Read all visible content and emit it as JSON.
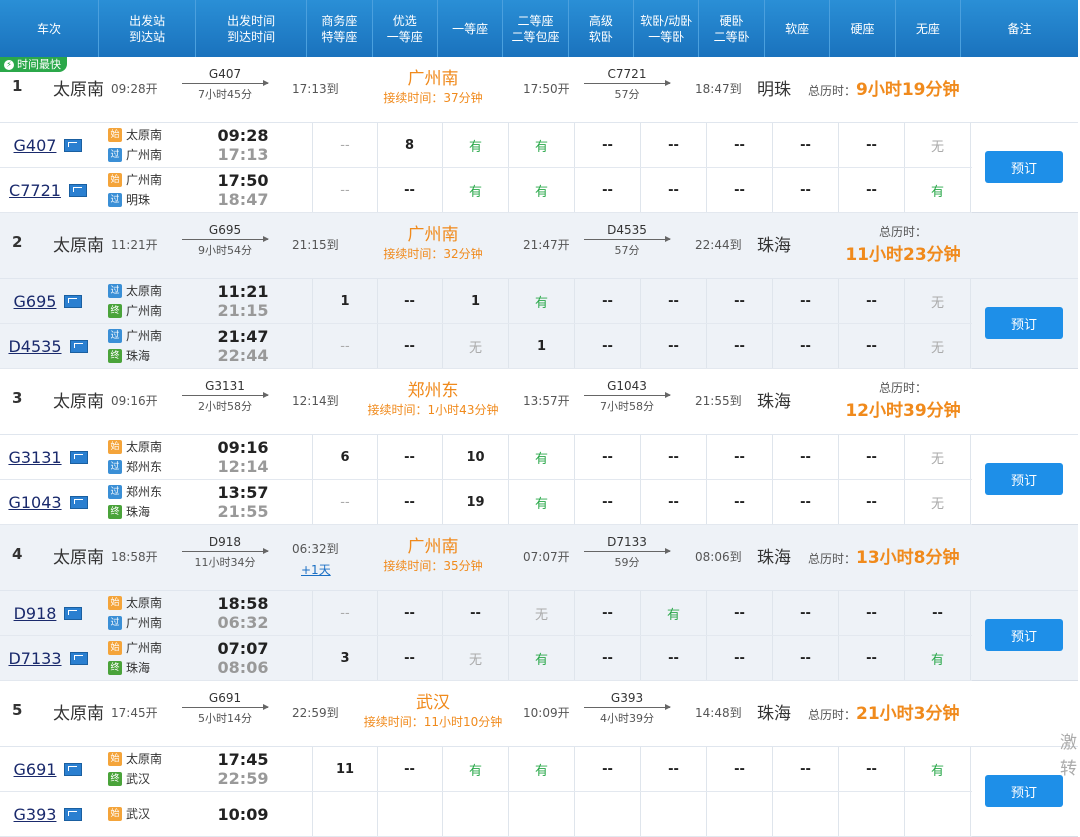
{
  "header": [
    "车次",
    "出发站\n到达站",
    "出发时间\n到达时间",
    "商务座\n特等座",
    "优选\n一等座",
    "一等座",
    "二等座\n二等包座",
    "高级\n软卧",
    "软卧/动卧\n一等卧",
    "硬卧\n二等卧",
    "软座",
    "硬座",
    "无座",
    "备注"
  ],
  "fast_tag": "时间最快",
  "book_label": "预订",
  "side_text": "激\n转",
  "groups": [
    {
      "idx": "1",
      "from": "太原南",
      "dep": "09:28开",
      "leg1": {
        "train": "G407",
        "dur": "7小时45分"
      },
      "arr1": "17:13到",
      "plus": "",
      "transfer_station": "广州南",
      "transfer_time": "接续时间：37分钟",
      "dep2": "17:50开",
      "leg2": {
        "train": "C7721",
        "dur": "57分"
      },
      "arr2": "18:47到",
      "final": "明珠",
      "total_label": "总历时：",
      "total": "9小时19分钟",
      "total_wrap": false,
      "trains": [
        {
          "no": "G407",
          "s1": "太原南",
          "b1": "始",
          "s2": "广州南",
          "b2": "过",
          "t1": "09:28",
          "t2": "17:13",
          "seats": [
            "--",
            "8",
            "有",
            "有",
            "--",
            "--",
            "--",
            "--",
            "--",
            "无"
          ]
        },
        {
          "no": "C7721",
          "s1": "广州南",
          "b1": "始",
          "s2": "明珠",
          "b2": "过",
          "t1": "17:50",
          "t2": "18:47",
          "seats": [
            "--",
            "--",
            "有",
            "有",
            "--",
            "--",
            "--",
            "--",
            "--",
            "有"
          ]
        }
      ]
    },
    {
      "idx": "2",
      "from": "太原南",
      "dep": "11:21开",
      "leg1": {
        "train": "G695",
        "dur": "9小时54分"
      },
      "arr1": "21:15到",
      "plus": "",
      "transfer_station": "广州南",
      "transfer_time": "接续时间：32分钟",
      "dep2": "21:47开",
      "leg2": {
        "train": "D4535",
        "dur": "57分"
      },
      "arr2": "22:44到",
      "final": "珠海",
      "total_label": "总历时：",
      "total": "11小时23分钟",
      "total_wrap": true,
      "trains": [
        {
          "no": "G695",
          "s1": "太原南",
          "b1": "过",
          "s2": "广州南",
          "b2": "终",
          "t1": "11:21",
          "t2": "21:15",
          "seats": [
            "1",
            "--",
            "1",
            "有",
            "--",
            "--",
            "--",
            "--",
            "--",
            "无"
          ]
        },
        {
          "no": "D4535",
          "s1": "广州南",
          "b1": "过",
          "s2": "珠海",
          "b2": "终",
          "t1": "21:47",
          "t2": "22:44",
          "seats": [
            "--",
            "--",
            "无",
            "1",
            "--",
            "--",
            "--",
            "--",
            "--",
            "无"
          ]
        }
      ]
    },
    {
      "idx": "3",
      "from": "太原南",
      "dep": "09:16开",
      "leg1": {
        "train": "G3131",
        "dur": "2小时58分"
      },
      "arr1": "12:14到",
      "plus": "",
      "transfer_station": "郑州东",
      "transfer_time": "接续时间：1小时43分钟",
      "dep2": "13:57开",
      "leg2": {
        "train": "G1043",
        "dur": "7小时58分"
      },
      "arr2": "21:55到",
      "final": "珠海",
      "total_label": "总历时：",
      "total": "12小时39分钟",
      "total_wrap": true,
      "trains": [
        {
          "no": "G3131",
          "s1": "太原南",
          "b1": "始",
          "s2": "郑州东",
          "b2": "过",
          "t1": "09:16",
          "t2": "12:14",
          "seats": [
            "6",
            "--",
            "10",
            "有",
            "--",
            "--",
            "--",
            "--",
            "--",
            "无"
          ]
        },
        {
          "no": "G1043",
          "s1": "郑州东",
          "b1": "过",
          "s2": "珠海",
          "b2": "终",
          "t1": "13:57",
          "t2": "21:55",
          "seats": [
            "--",
            "--",
            "19",
            "有",
            "--",
            "--",
            "--",
            "--",
            "--",
            "无"
          ]
        }
      ]
    },
    {
      "idx": "4",
      "from": "太原南",
      "dep": "18:58开",
      "leg1": {
        "train": "D918",
        "dur": "11小时34分"
      },
      "arr1": "06:32到",
      "plus": "+1天",
      "transfer_station": "广州南",
      "transfer_time": "接续时间：35分钟",
      "dep2": "07:07开",
      "leg2": {
        "train": "D7133",
        "dur": "59分"
      },
      "arr2": "08:06到",
      "final": "珠海",
      "total_label": "总历时：",
      "total": "13小时8分钟",
      "total_wrap": false,
      "trains": [
        {
          "no": "D918",
          "s1": "太原南",
          "b1": "始",
          "s2": "广州南",
          "b2": "过",
          "t1": "18:58",
          "t2": "06:32",
          "seats": [
            "--",
            "--",
            "--",
            "无",
            "--",
            "有",
            "--",
            "--",
            "--",
            "--"
          ]
        },
        {
          "no": "D7133",
          "s1": "广州南",
          "b1": "始",
          "s2": "珠海",
          "b2": "终",
          "t1": "07:07",
          "t2": "08:06",
          "seats": [
            "3",
            "--",
            "无",
            "有",
            "--",
            "--",
            "--",
            "--",
            "--",
            "有"
          ]
        }
      ]
    },
    {
      "idx": "5",
      "from": "太原南",
      "dep": "17:45开",
      "leg1": {
        "train": "G691",
        "dur": "5小时14分"
      },
      "arr1": "22:59到",
      "plus": "",
      "transfer_station": "武汉",
      "transfer_time": "接续时间：11小时10分钟",
      "dep2": "10:09开",
      "leg2": {
        "train": "G393",
        "dur": "4小时39分"
      },
      "arr2": "14:48到",
      "final": "珠海",
      "total_label": "总历时：",
      "total": "21小时3分钟",
      "total_wrap": false,
      "trains": [
        {
          "no": "G691",
          "s1": "太原南",
          "b1": "始",
          "s2": "武汉",
          "b2": "终",
          "t1": "17:45",
          "t2": "22:59",
          "seats": [
            "11",
            "--",
            "有",
            "有",
            "--",
            "--",
            "--",
            "--",
            "--",
            "有"
          ]
        },
        {
          "no": "G393",
          "s1": "武汉",
          "b1": "始",
          "s2": "",
          "b2": "",
          "t1": "10:09",
          "t2": "",
          "seats": [
            "",
            "",
            "",
            "",
            "",
            "",
            "",
            "",
            "",
            ""
          ]
        }
      ]
    }
  ]
}
